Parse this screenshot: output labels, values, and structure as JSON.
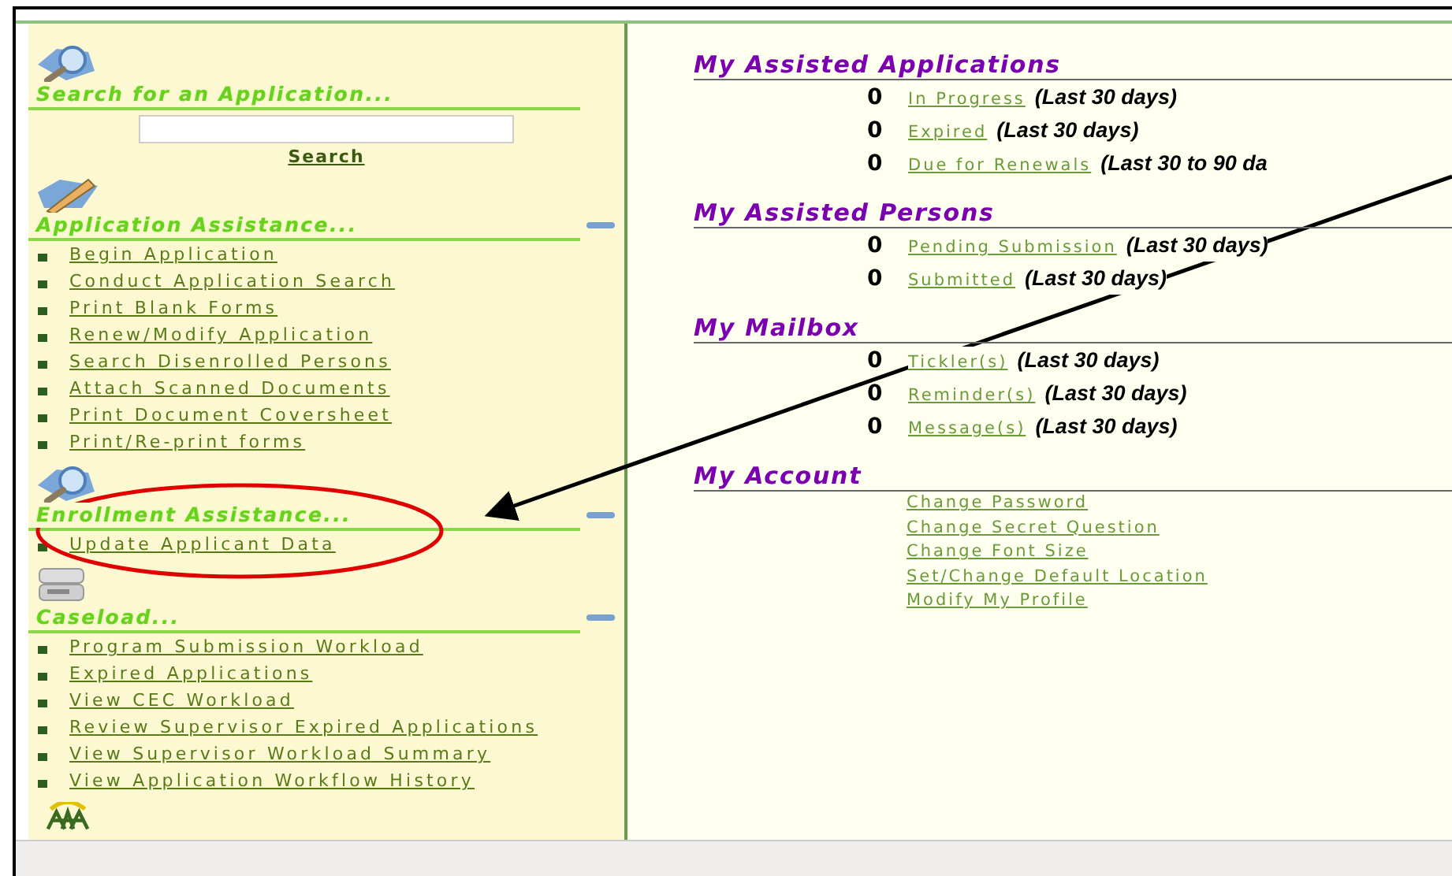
{
  "sidebar": {
    "sections": [
      {
        "kind": "search",
        "title": "Search for an Application...",
        "collapsible": false,
        "button": "Search"
      },
      {
        "kind": "links",
        "title": "Application Assistance...",
        "collapsible": true,
        "items": [
          "Begin Application",
          "Conduct Application Search",
          "Print Blank Forms",
          "Renew/Modify Application",
          "Search Disenrolled Persons",
          "Attach Scanned Documents",
          "Print Document Coversheet",
          "Print/Re-print forms"
        ]
      },
      {
        "kind": "links",
        "title": "Enrollment Assistance...",
        "collapsible": true,
        "items": [
          "Update Applicant Data"
        ]
      },
      {
        "kind": "links",
        "title": "Caseload...",
        "collapsible": true,
        "items": [
          "Program Submission Workload",
          "Expired Applications",
          "View CEC Workload",
          "Review Supervisor Expired Applications",
          "View Supervisor Workload Summary",
          "View Application Workflow History"
        ]
      },
      {
        "kind": "logo"
      }
    ]
  },
  "main": {
    "sections": [
      {
        "kind": "counts",
        "title": "My Assisted Applications",
        "rows": [
          {
            "count": "0",
            "link": "In Progress",
            "period": "(Last 30 days)"
          },
          {
            "count": "0",
            "link": "Expired",
            "period": "(Last 30 days)"
          },
          {
            "count": "0",
            "link": "Due for Renewals",
            "period": "(Last 30 to 90 da"
          }
        ]
      },
      {
        "kind": "counts",
        "title": "My Assisted Persons",
        "rows": [
          {
            "count": "0",
            "link": "Pending Submission",
            "period": "(Last 30 days)"
          },
          {
            "count": "0",
            "link": "Submitted",
            "period": "(Last 30 days)"
          }
        ]
      },
      {
        "kind": "counts",
        "title": "My Mailbox",
        "rows": [
          {
            "count": "0",
            "link": "Tickler(s)",
            "period": "(Last 30 days)"
          },
          {
            "count": "0",
            "link": "Reminder(s)",
            "period": "(Last 30 days)"
          },
          {
            "count": "0",
            "link": "Message(s)",
            "period": "(Last 30 days)"
          }
        ]
      },
      {
        "kind": "links",
        "title": "My Account",
        "links": [
          "Change Password",
          "Change Secret Question",
          "Change Font Size",
          "Set/Change Default Location",
          "Modify My Profile"
        ]
      }
    ]
  }
}
